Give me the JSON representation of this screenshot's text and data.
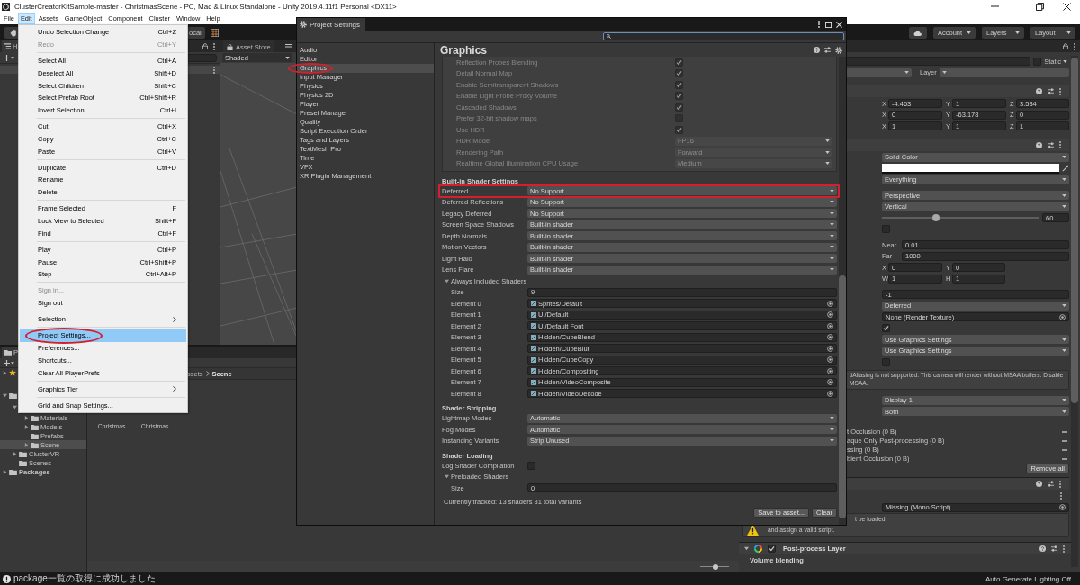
{
  "window": {
    "title": "ClusterCreatorKitSample-master - ChristmasScene - PC, Mac & Linux Standalone - Unity 2019.4.11f1 Personal <DX11>"
  },
  "menu_bar": [
    {
      "label": "File",
      "selected": false
    },
    {
      "label": "Edit",
      "selected": true
    },
    {
      "label": "Assets",
      "selected": false
    },
    {
      "label": "GameObject",
      "selected": false
    },
    {
      "label": "Component",
      "selected": false
    },
    {
      "label": "Cluster",
      "selected": false
    },
    {
      "label": "Window",
      "selected": false
    },
    {
      "label": "Help",
      "selected": false
    }
  ],
  "edit_menu": [
    {
      "kind": "item",
      "label": "Undo Selection Change",
      "shortcut": "Ctrl+Z",
      "disabled": false,
      "selected": false,
      "submenu": false,
      "circled": false
    },
    {
      "kind": "item",
      "label": "Redo",
      "shortcut": "Ctrl+Y",
      "disabled": true,
      "selected": false,
      "submenu": false,
      "circled": false
    },
    {
      "kind": "separator"
    },
    {
      "kind": "item",
      "label": "Select All",
      "shortcut": "Ctrl+A",
      "disabled": false,
      "selected": false,
      "submenu": false,
      "circled": false
    },
    {
      "kind": "item",
      "label": "Deselect All",
      "shortcut": "Shift+D",
      "disabled": false,
      "selected": false,
      "submenu": false,
      "circled": false
    },
    {
      "kind": "item",
      "label": "Select Children",
      "shortcut": "Shift+C",
      "disabled": false,
      "selected": false,
      "submenu": false,
      "circled": false
    },
    {
      "kind": "item",
      "label": "Select Prefab Root",
      "shortcut": "Ctrl+Shift+R",
      "disabled": false,
      "selected": false,
      "submenu": false,
      "circled": false
    },
    {
      "kind": "item",
      "label": "Invert Selection",
      "shortcut": "Ctrl+I",
      "disabled": false,
      "selected": false,
      "submenu": false,
      "circled": false
    },
    {
      "kind": "separator"
    },
    {
      "kind": "item",
      "label": "Cut",
      "shortcut": "Ctrl+X",
      "disabled": false,
      "selected": false,
      "submenu": false,
      "circled": false
    },
    {
      "kind": "item",
      "label": "Copy",
      "shortcut": "Ctrl+C",
      "disabled": false,
      "selected": false,
      "submenu": false,
      "circled": false
    },
    {
      "kind": "item",
      "label": "Paste",
      "shortcut": "Ctrl+V",
      "disabled": false,
      "selected": false,
      "submenu": false,
      "circled": false
    },
    {
      "kind": "separator"
    },
    {
      "kind": "item",
      "label": "Duplicate",
      "shortcut": "Ctrl+D",
      "disabled": false,
      "selected": false,
      "submenu": false,
      "circled": false
    },
    {
      "kind": "item",
      "label": "Rename",
      "disabled": false,
      "selected": false,
      "submenu": false,
      "circled": false
    },
    {
      "kind": "item",
      "label": "Delete",
      "disabled": false,
      "selected": false,
      "submenu": false,
      "circled": false
    },
    {
      "kind": "separator"
    },
    {
      "kind": "item",
      "label": "Frame Selected",
      "shortcut": "F",
      "disabled": false,
      "selected": false,
      "submenu": false,
      "circled": false
    },
    {
      "kind": "item",
      "label": "Lock View to Selected",
      "shortcut": "Shift+F",
      "disabled": false,
      "selected": false,
      "submenu": false,
      "circled": false
    },
    {
      "kind": "item",
      "label": "Find",
      "shortcut": "Ctrl+F",
      "disabled": false,
      "selected": false,
      "submenu": false,
      "circled": false
    },
    {
      "kind": "separator"
    },
    {
      "kind": "item",
      "label": "Play",
      "shortcut": "Ctrl+P",
      "disabled": false,
      "selected": false,
      "submenu": false,
      "circled": false
    },
    {
      "kind": "item",
      "label": "Pause",
      "shortcut": "Ctrl+Shift+P",
      "disabled": false,
      "selected": false,
      "submenu": false,
      "circled": false
    },
    {
      "kind": "item",
      "label": "Step",
      "shortcut": "Ctrl+Alt+P",
      "disabled": false,
      "selected": false,
      "submenu": false,
      "circled": false
    },
    {
      "kind": "separator"
    },
    {
      "kind": "item",
      "label": "Sign in...",
      "disabled": true,
      "selected": false,
      "submenu": false,
      "circled": false
    },
    {
      "kind": "item",
      "label": "Sign out",
      "disabled": false,
      "selected": false,
      "submenu": false,
      "circled": false
    },
    {
      "kind": "separator"
    },
    {
      "kind": "item",
      "label": "Selection",
      "disabled": false,
      "selected": false,
      "submenu": true,
      "circled": false
    },
    {
      "kind": "separator"
    },
    {
      "kind": "item",
      "label": "Project Settings...",
      "disabled": false,
      "selected": true,
      "submenu": false,
      "circled": true
    },
    {
      "kind": "item",
      "label": "Preferences...",
      "disabled": false,
      "selected": false,
      "submenu": false,
      "circled": false
    },
    {
      "kind": "item",
      "label": "Shortcuts...",
      "disabled": false,
      "selected": false,
      "submenu": false,
      "circled": false
    },
    {
      "kind": "item",
      "label": "Clear All PlayerPrefs",
      "disabled": false,
      "selected": false,
      "submenu": false,
      "circled": false
    },
    {
      "kind": "separator"
    },
    {
      "kind": "item",
      "label": "Graphics Tier",
      "disabled": false,
      "selected": false,
      "submenu": true,
      "circled": false
    },
    {
      "kind": "separator"
    },
    {
      "kind": "item",
      "label": "Grid and Snap Settings...",
      "disabled": false,
      "selected": false,
      "submenu": false,
      "circled": false
    }
  ],
  "toolbar": {
    "pivot_button": "ocal",
    "right_buttons": [
      {
        "label": "Account"
      },
      {
        "label": "Layers"
      },
      {
        "label": "Layout"
      }
    ]
  },
  "hierarchy": {
    "tab_label": "H",
    "rows": [
      {
        "kind": "scene",
        "selected": false
      }
    ]
  },
  "scene_view": {
    "tabs": [
      {
        "label": "Asset Store",
        "selected": false
      }
    ],
    "shading_mode": "Shaded"
  },
  "project_settings": {
    "title": "Project Settings",
    "categories": [
      {
        "label": "Audio",
        "selected": false,
        "circled": false
      },
      {
        "label": "Editor",
        "selected": false,
        "circled": false
      },
      {
        "label": "Graphics",
        "selected": true,
        "circled": true
      },
      {
        "label": "Input Manager",
        "selected": false,
        "circled": false
      },
      {
        "label": "Physics",
        "selected": false,
        "circled": false
      },
      {
        "label": "Physics 2D",
        "selected": false,
        "circled": false
      },
      {
        "label": "Player",
        "selected": false,
        "circled": false
      },
      {
        "label": "Preset Manager",
        "selected": false,
        "circled": false
      },
      {
        "label": "Quality",
        "selected": false,
        "circled": false
      },
      {
        "label": "Script Execution Order",
        "selected": false,
        "circled": false
      },
      {
        "label": "Tags and Layers",
        "selected": false,
        "circled": false
      },
      {
        "label": "TextMesh Pro",
        "selected": false,
        "circled": false
      },
      {
        "label": "Time",
        "selected": false,
        "circled": false
      },
      {
        "label": "VFX",
        "selected": false,
        "circled": false
      },
      {
        "label": "XR Plugin Management",
        "selected": false,
        "circled": false
      }
    ],
    "heading": "Graphics",
    "pane": [
      {
        "kind": "group",
        "disabled": true,
        "boxed": false,
        "children": [
          {
            "kind": "checkbox",
            "label": "Reflection Probes Blending",
            "checked": true
          },
          {
            "kind": "checkbox",
            "label": "Detail Normal Map",
            "checked": true
          },
          {
            "kind": "checkbox",
            "label": "Enable Semitransparent Shadows",
            "checked": true
          },
          {
            "kind": "checkbox",
            "label": "Enable Light Probe Proxy Volume",
            "checked": true
          },
          {
            "kind": "checkbox",
            "label": "Cascaded Shadows",
            "checked": true
          },
          {
            "kind": "checkbox",
            "label": "Prefer 32-bit shadow maps",
            "checked": false
          },
          {
            "kind": "checkbox",
            "label": "Use HDR",
            "checked": true
          },
          {
            "kind": "dropdown",
            "label": "HDR Mode",
            "value": "FP16"
          },
          {
            "kind": "dropdown",
            "label": "Rendering Path",
            "value": "Forward"
          },
          {
            "kind": "dropdown",
            "label": "Realtime Global Illumination CPU Usage",
            "value": "Medium"
          }
        ]
      },
      {
        "kind": "header",
        "label": "Built-in Shader Settings",
        "boxed": false
      },
      {
        "kind": "dropdown",
        "label": "Deferred",
        "value": "No Support",
        "boxed": true
      },
      {
        "kind": "dropdown",
        "label": "Deferred Reflections",
        "value": "No Support",
        "boxed": false
      },
      {
        "kind": "dropdown",
        "label": "Legacy Deferred",
        "value": "No Support",
        "boxed": false
      },
      {
        "kind": "dropdown",
        "label": "Screen Space Shadows",
        "value": "Built-in shader",
        "boxed": false
      },
      {
        "kind": "dropdown",
        "label": "Depth Normals",
        "value": "Built-in shader",
        "boxed": false
      },
      {
        "kind": "dropdown",
        "label": "Motion Vectors",
        "value": "Built-in shader",
        "boxed": false
      },
      {
        "kind": "dropdown",
        "label": "Light Halo",
        "value": "Built-in shader",
        "boxed": false
      },
      {
        "kind": "dropdown",
        "label": "Lens Flare",
        "value": "Built-in shader",
        "boxed": false
      },
      {
        "kind": "foldout",
        "label": "Always Included Shaders",
        "expanded": true,
        "boxed": false,
        "children": [
          {
            "kind": "field",
            "label": "Size",
            "value": "9"
          },
          {
            "kind": "object",
            "label": "Element 0",
            "value": "Sprites/Default"
          },
          {
            "kind": "object",
            "label": "Element 1",
            "value": "UI/Default"
          },
          {
            "kind": "object",
            "label": "Element 2",
            "value": "UI/Default Font"
          },
          {
            "kind": "object",
            "label": "Element 3",
            "value": "Hidden/CubeBlend"
          },
          {
            "kind": "object",
            "label": "Element 4",
            "value": "Hidden/CubeBlur"
          },
          {
            "kind": "object",
            "label": "Element 5",
            "value": "Hidden/CubeCopy"
          },
          {
            "kind": "object",
            "label": "Element 6",
            "value": "Hidden/Compositing"
          },
          {
            "kind": "object",
            "label": "Element 7",
            "value": "Hidden/VideoComposite"
          },
          {
            "kind": "object",
            "label": "Element 8",
            "value": "Hidden/VideoDecode"
          }
        ]
      },
      {
        "kind": "header",
        "label": "Shader Stripping",
        "boxed": false
      },
      {
        "kind": "dropdown",
        "label": "Lightmap Modes",
        "value": "Automatic",
        "boxed": false
      },
      {
        "kind": "dropdown",
        "label": "Fog Modes",
        "value": "Automatic",
        "boxed": false
      },
      {
        "kind": "dropdown",
        "label": "Instancing Variants",
        "value": "Strip Unused",
        "boxed": false
      },
      {
        "kind": "header",
        "label": "Shader Loading",
        "boxed": false
      },
      {
        "kind": "checkbox",
        "label": "Log Shader Compilation",
        "checked": false,
        "boxed": false
      },
      {
        "kind": "foldout",
        "label": "Preloaded Shaders",
        "expanded": true,
        "boxed": false,
        "children": [
          {
            "kind": "field",
            "label": "Size",
            "value": "0"
          }
        ]
      },
      {
        "kind": "note",
        "label": "Currently tracked: 13 shaders 31 total variants",
        "boxed": false
      },
      {
        "kind": "buttons",
        "boxed": false,
        "buttons": [
          {
            "label": "Save to asset..."
          },
          {
            "label": "Clear"
          }
        ]
      }
    ]
  },
  "inspector": {
    "rows": [
      {
        "kind": "name",
        "static_label": "Static",
        "static_checked": false
      },
      {
        "kind": "tag",
        "layer_label": "Layer"
      },
      {
        "kind": "header"
      },
      {
        "kind": "vector",
        "values": [
          {
            "axis": "X",
            "value": "-4.463"
          },
          {
            "axis": "Y",
            "value": "1"
          },
          {
            "axis": "Z",
            "value": "3.534"
          }
        ]
      },
      {
        "kind": "vector",
        "values": [
          {
            "axis": "X",
            "value": "0"
          },
          {
            "axis": "Y",
            "value": "-63.178"
          },
          {
            "axis": "Z",
            "value": "0"
          }
        ]
      },
      {
        "kind": "vector",
        "values": [
          {
            "axis": "X",
            "value": "1"
          },
          {
            "axis": "Y",
            "value": "1"
          },
          {
            "axis": "Z",
            "value": "1"
          }
        ]
      },
      {
        "kind": "header"
      },
      {
        "kind": "dropdown",
        "value": "Solid Color"
      },
      {
        "kind": "color",
        "color": "#ffffff"
      },
      {
        "kind": "dropdown",
        "value": "Everything"
      },
      {
        "kind": "dropdown",
        "value": "Perspective"
      },
      {
        "kind": "dropdown",
        "value": "Vertical"
      },
      {
        "kind": "slider",
        "level": 0.34,
        "value": "60"
      },
      {
        "kind": "checkbox",
        "checked": false
      },
      {
        "kind": "field",
        "label": "Near",
        "value": "0.01"
      },
      {
        "kind": "field",
        "label": "Far",
        "value": "1000"
      },
      {
        "kind": "vector",
        "values": [
          {
            "axis": "X",
            "value": "0"
          },
          {
            "axis": "Y",
            "value": "0"
          }
        ]
      },
      {
        "kind": "vector",
        "values": [
          {
            "axis": "W",
            "value": "1"
          },
          {
            "axis": "H",
            "value": "1"
          }
        ]
      },
      {
        "kind": "field",
        "value": "-1"
      },
      {
        "kind": "dropdown",
        "value": "Deferred"
      },
      {
        "kind": "object",
        "value": "None (Render Texture)"
      },
      {
        "kind": "checkbox",
        "checked": true
      },
      {
        "kind": "dropdown",
        "value": "Use Graphics Settings"
      },
      {
        "kind": "dropdown",
        "value": "Use Graphics Settings"
      },
      {
        "kind": "checkbox",
        "checked": false
      },
      {
        "kind": "help",
        "text": "tiAliasing is not supported. This camera will render without MSAA buffers. Disable MSAA."
      },
      {
        "kind": "dropdown",
        "value": "Display 1"
      },
      {
        "kind": "dropdown",
        "value": "Both"
      },
      {
        "kind": "list_item",
        "label": "t Occlusion (0 B)"
      },
      {
        "kind": "list_item",
        "label": "aque Only Post-processing (0 B)"
      },
      {
        "kind": "list_item",
        "label": "ssing (0 B)"
      },
      {
        "kind": "list_item",
        "label": "bient Occlusion (0 B)"
      },
      {
        "kind": "button",
        "label": "Remove all"
      },
      {
        "kind": "header"
      },
      {
        "kind": "menu_row"
      },
      {
        "kind": "object",
        "value": "Missing (Mono Script)"
      },
      {
        "kind": "warning",
        "lines": [
          "t be loaded.",
          "and assign a valid script."
        ]
      },
      {
        "kind": "component",
        "title": "Post-process Layer",
        "expanded": true,
        "enabled": true
      },
      {
        "kind": "label",
        "label": "Volume blending"
      }
    ]
  },
  "project_panel": {
    "tab_label": "P",
    "tree": [
      {
        "kind": "favorites",
        "expanded": false,
        "selected": false
      },
      {
        "kind": "folder",
        "expanded": true,
        "selected": false,
        "children": [
          {
            "expanded": true,
            "selected": false,
            "children": [
              {
                "kind": "folder",
                "label": "Materials",
                "expanded": false,
                "selected": false
              },
              {
                "kind": "folder",
                "label": "Models",
                "expanded": false,
                "selected": false
              },
              {
                "kind": "folder",
                "label": "Prefabs",
                "selected": false
              },
              {
                "kind": "folder",
                "label": "Scene",
                "expanded": false,
                "selected": true
              }
            ]
          },
          {
            "kind": "folder",
            "label": "ClusterVR",
            "expanded": false,
            "selected": false
          },
          {
            "kind": "folder",
            "label": "Scenes",
            "selected": false
          }
        ]
      },
      {
        "kind": "folder",
        "label": "Packages",
        "expanded": false,
        "selected": false
      }
    ],
    "breadcrumb": [
      "ssets",
      "Scene"
    ],
    "assets": [
      {
        "label": "Christmas..."
      },
      {
        "label": "Christmas..."
      }
    ],
    "zoom_slider": {
      "level": 0.53
    }
  },
  "status_bar": {
    "message": "package一覧の取得に成功しました",
    "lighting": "Auto Generate Lighting Off"
  }
}
